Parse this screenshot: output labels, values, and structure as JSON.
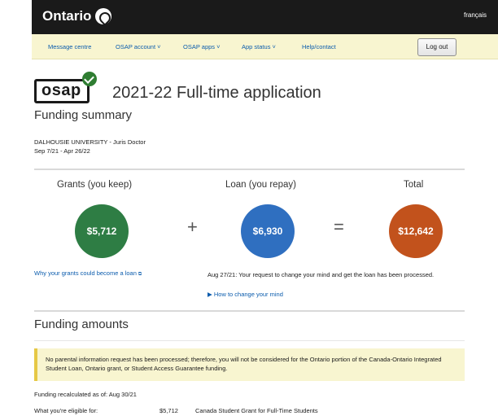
{
  "header": {
    "brand": "Ontario",
    "language_link": "français"
  },
  "nav": {
    "items": [
      "Message centre",
      "OSAP account ˅",
      "OSAP apps ˅",
      "App status ˅",
      "Help/contact"
    ],
    "logout_label": "Log out"
  },
  "application": {
    "logo_text": "osap",
    "title": "2021-22 Full-time application",
    "section_title": "Funding summary",
    "school": "DALHOUSIE UNIVERSITY - Juris Doctor",
    "dates": "Sep 7/21 - Apr 26/22"
  },
  "summary": {
    "grants_label": "Grants (you keep)",
    "grants_amount": "$5,712",
    "plus": "+",
    "loan_label": "Loan (you repay)",
    "loan_amount": "$6,930",
    "equals": "=",
    "total_label": "Total",
    "total_amount": "$12,642",
    "colors": {
      "grants": "#2e7d44",
      "loan": "#2f6fc0",
      "total": "#c2521c"
    }
  },
  "notes": {
    "grants_link": "Why your grants could become a loan",
    "change_mind_text": "Aug 27/21: Your request to change your mind and get the loan has been processed.",
    "how_link": "▶ How to change your mind"
  },
  "funding_amounts": {
    "title": "Funding amounts",
    "alert": "No parental information request has been processed; therefore, you will not be considered for the Ontario portion of the Canada-Ontario Integrated Student Loan, Ontario grant, or Student Access Guarantee funding.",
    "recalculated": "Funding recalculated as of: Aug 30/21",
    "eligible_label": "What you're eligible for:",
    "eligible_amount": "$5,712",
    "eligible_description": "Canada Student Grant for Full-Time Students"
  }
}
